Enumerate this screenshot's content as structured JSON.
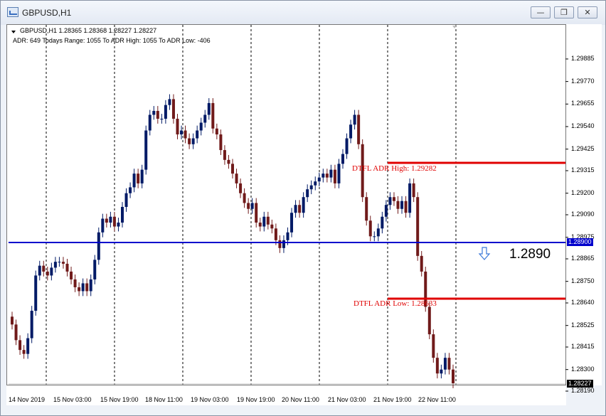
{
  "window": {
    "title": "GBPUSD,H1",
    "buttons": {
      "minimize": "—",
      "restore": "❐",
      "close": "✕"
    }
  },
  "info": {
    "symbol_line": "GBPUSD,H1  1.28365 1.28368 1.28227 1.28227",
    "adr_line": "ADR: 649  Todays Range: 1055  To ADR High: 1055  To ADR Low: -406"
  },
  "price_axis": {
    "labels": [
      "1.29885",
      "1.29770",
      "1.29655",
      "1.29540",
      "1.29425",
      "1.29315",
      "1.29200",
      "1.29090",
      "1.28975",
      "1.28865",
      "1.28750",
      "1.28640",
      "1.28525",
      "1.28415",
      "1.28300",
      "1.28190"
    ],
    "blue_tag": "1.28900",
    "current_tag": "1.28227"
  },
  "time_axis": {
    "labels": [
      "14 Nov 2019",
      "15 Nov 03:00",
      "15 Nov 19:00",
      "18 Nov 11:00",
      "19 Nov 03:00",
      "19 Nov 19:00",
      "20 Nov 11:00",
      "21 Nov 03:00",
      "21 Nov 19:00",
      "22 Nov 11:00"
    ]
  },
  "annotations": {
    "adr_high": "DTFL ADR High: 1.29282",
    "adr_low": "DTFL ADR Low: 1.28633",
    "big_price": "1.2890"
  },
  "chart_data": {
    "type": "candlestick",
    "symbol": "GBPUSD",
    "timeframe": "H1",
    "ylim": [
      1.2819,
      1.2999
    ],
    "closes": [
      1.2853,
      1.2845,
      1.284,
      1.2838,
      1.2846,
      1.286,
      1.2878,
      1.2883,
      1.288,
      1.2878,
      1.2882,
      1.2885,
      1.2885,
      1.2884,
      1.288,
      1.2876,
      1.2872,
      1.287,
      1.2874,
      1.287,
      1.2876,
      1.2886,
      1.29,
      1.2907,
      1.2905,
      1.2908,
      1.2903,
      1.2905,
      1.2913,
      1.292,
      1.2923,
      1.293,
      1.2925,
      1.2932,
      1.2952,
      1.296,
      1.2962,
      1.2958,
      1.2958,
      1.2965,
      1.2968,
      1.2958,
      1.295,
      1.2952,
      1.2948,
      1.2945,
      1.2948,
      1.2952,
      1.2956,
      1.296,
      1.2966,
      1.2953,
      1.295,
      1.2942,
      1.2937,
      1.2935,
      1.293,
      1.2925,
      1.292,
      1.2915,
      1.2912,
      1.2915,
      1.2905,
      1.2903,
      1.2908,
      1.2904,
      1.2902,
      1.2896,
      1.2892,
      1.2896,
      1.29,
      1.291,
      1.2914,
      1.291,
      1.2918,
      1.2922,
      1.2924,
      1.2926,
      1.2928,
      1.293,
      1.2928,
      1.2932,
      1.2925,
      1.2935,
      1.294,
      1.2948,
      1.2955,
      1.296,
      1.2945,
      1.2918,
      1.2906,
      1.2898,
      1.2898,
      1.2902,
      1.2908,
      1.2914,
      1.2918,
      1.2916,
      1.2912,
      1.2916,
      1.291,
      1.2925,
      1.2918,
      1.2888,
      1.288,
      1.2862,
      1.2848,
      1.2836,
      1.2828,
      1.283,
      1.2836,
      1.283,
      1.2823
    ]
  },
  "colors": {
    "bull": "#001a66",
    "bear": "#701a1a",
    "support_line": "#0000cc",
    "adr_line": "#e00000",
    "background": "#ffffff"
  }
}
